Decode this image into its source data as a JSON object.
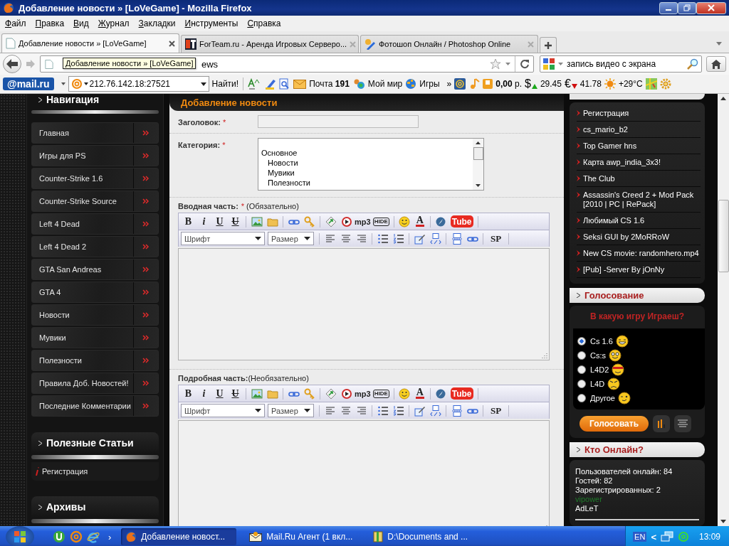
{
  "window": {
    "title": "Добавление новости » [LoVeGame] - Mozilla Firefox"
  },
  "menu": [
    "Файл",
    "Правка",
    "Вид",
    "Журнал",
    "Закладки",
    "Инструменты",
    "Справка"
  ],
  "tabs": [
    {
      "title": "Добавление новости » [LoVeGame]",
      "selected": true,
      "kind": "page"
    },
    {
      "title": "ForTeam.ru - Аренда Игровых Серверо...",
      "selected": false,
      "kind": "ft"
    },
    {
      "title": "Фотошоп Онлайн / Photoshop Online",
      "selected": false,
      "kind": "paint"
    }
  ],
  "address": {
    "value": "ews",
    "tooltip": "Добавление новости » [LoVeGame]"
  },
  "search": {
    "value": "запись видео с экрана"
  },
  "mail_toolbar": {
    "logo": "@mail.ru",
    "query": "212.76.142.18:27521",
    "find": "Найти!",
    "mail": "Почта **191**",
    "myworld": "Мой мир",
    "games": "Игры",
    "more": "»",
    "balance": "**0,00** р.",
    "rates": [
      {
        "symbol": "$",
        "rising": true,
        "value": "29.45"
      },
      {
        "symbol": "€",
        "rising": false,
        "value": "41.78"
      }
    ],
    "weather": "+29°C"
  },
  "nav": {
    "title": "Навигация",
    "items": [
      "Главная",
      "Игры для PS",
      "Counter-Strike 1.6",
      "Counter-Strike Source",
      "Left 4 Dead",
      "Left 4 Dead 2",
      "GTA San Andreas",
      "GTA 4",
      "Новости",
      "Мувики",
      "Полезности",
      "Правила Доб. Новостей!",
      "Последние Комментарии"
    ]
  },
  "articles": {
    "title": "Полезные Статьи",
    "items": [
      "Регистрация"
    ]
  },
  "archives": {
    "title": "Архивы"
  },
  "form": {
    "title": "Добавление новости",
    "title_field": {
      "label": "Заголовок:",
      "mark": "*"
    },
    "category": {
      "label": "Категория:",
      "mark": "*",
      "options": [
        {
          "text": "Основное",
          "selected": false,
          "children": [
            {
              "text": "Новости",
              "selected": false
            },
            {
              "text": "Мувики",
              "selected": false
            },
            {
              "text": "Полезности",
              "selected": false
            }
          ]
        }
      ]
    },
    "editors": [
      {
        "label": "Вводная часть:",
        "mark": "*",
        "note": "(Обязательно)",
        "toolbar": [
          [
            {
              "kind": "bold",
              "label": "B"
            },
            {
              "kind": "italic",
              "label": "i"
            },
            {
              "kind": "underline",
              "label": "U"
            },
            {
              "kind": "strike",
              "label": "U"
            },
            {
              "kind": "sep"
            },
            {
              "kind": "image"
            },
            {
              "kind": "folder"
            },
            {
              "kind": "sep"
            },
            {
              "kind": "link"
            },
            {
              "kind": "key"
            },
            {
              "kind": "sep"
            },
            {
              "kind": "leaf"
            },
            {
              "kind": "play"
            },
            {
              "kind": "mp3",
              "label": "mp3"
            },
            {
              "kind": "hide",
              "label": "HIDE"
            },
            {
              "kind": "sep"
            },
            {
              "kind": "smiley"
            },
            {
              "kind": "color",
              "label": "A"
            },
            {
              "kind": "sep"
            },
            {
              "kind": "compass"
            },
            {
              "kind": "tube",
              "label": "Tube"
            },
            {
              "kind": "sep"
            }
          ],
          [
            {
              "kind": "select",
              "label": "Шрифт"
            },
            {
              "kind": "select",
              "label": "Размер"
            },
            {
              "kind": "sep"
            },
            {
              "kind": "align-left"
            },
            {
              "kind": "align-center"
            },
            {
              "kind": "align-right"
            },
            {
              "kind": "sep"
            },
            {
              "kind": "ul"
            },
            {
              "kind": "ol"
            },
            {
              "kind": "sep"
            },
            {
              "kind": "edit"
            },
            {
              "kind": "code"
            },
            {
              "kind": "sep"
            },
            {
              "kind": "page"
            },
            {
              "kind": "link2"
            },
            {
              "kind": "sep"
            },
            {
              "kind": "sp",
              "label": "SP"
            },
            {
              "kind": "sep"
            }
          ]
        ]
      },
      {
        "label": "Подробная часть:",
        "note": "(Необязательно)",
        "toolbar": [
          [
            {
              "kind": "bold",
              "label": "B"
            },
            {
              "kind": "italic",
              "label": "i"
            },
            {
              "kind": "underline",
              "label": "U"
            },
            {
              "kind": "strike",
              "label": "U"
            },
            {
              "kind": "sep"
            },
            {
              "kind": "image"
            },
            {
              "kind": "folder"
            },
            {
              "kind": "sep"
            },
            {
              "kind": "link"
            },
            {
              "kind": "key"
            },
            {
              "kind": "sep"
            },
            {
              "kind": "leaf"
            },
            {
              "kind": "play"
            },
            {
              "kind": "mp3",
              "label": "mp3"
            },
            {
              "kind": "hide",
              "label": "HIDE"
            },
            {
              "kind": "sep"
            },
            {
              "kind": "smiley"
            },
            {
              "kind": "color",
              "label": "A"
            },
            {
              "kind": "sep"
            },
            {
              "kind": "compass"
            },
            {
              "kind": "tube",
              "label": "Tube"
            },
            {
              "kind": "sep"
            }
          ],
          [
            {
              "kind": "select",
              "label": "Шрифт"
            },
            {
              "kind": "select",
              "label": "Размер"
            },
            {
              "kind": "sep"
            },
            {
              "kind": "align-left"
            },
            {
              "kind": "align-center"
            },
            {
              "kind": "align-right"
            },
            {
              "kind": "sep"
            },
            {
              "kind": "ul"
            },
            {
              "kind": "ol"
            },
            {
              "kind": "sep"
            },
            {
              "kind": "edit"
            },
            {
              "kind": "code"
            },
            {
              "kind": "sep"
            },
            {
              "kind": "page"
            },
            {
              "kind": "link2"
            },
            {
              "kind": "sep"
            },
            {
              "kind": "sp",
              "label": "SP"
            },
            {
              "kind": "sep"
            }
          ]
        ]
      }
    ]
  },
  "popular": {
    "items": [
      "Регистрация",
      "cs_mario_b2",
      "Top Gamer hns",
      "Карта awp_india_3x3!",
      "The Club",
      "Assassin's Creed 2 + Mod Pack [2010 | PC | RePack]",
      "Любимый CS 1.6",
      "Seksi GUI by 2MoRRoW",
      "New CS movie: randomhero.mp4",
      "[Pub] -Server By jOnNy"
    ]
  },
  "poll": {
    "title": "Голосование",
    "question": "В какую игру Играеш?",
    "options": [
      {
        "label": "Cs 1.6",
        "selected": true,
        "kind": "laugh"
      },
      {
        "label": "Cs:s",
        "selected": false,
        "kind": "smile"
      },
      {
        "label": "L4D2",
        "selected": false,
        "kind": "band"
      },
      {
        "label": "L4D",
        "selected": false,
        "kind": "angry"
      },
      {
        "label": "Другое",
        "selected": false,
        "kind": "wink"
      }
    ],
    "vote": "Голосовать"
  },
  "online": {
    "title": "Кто Онлайн?",
    "lines": [
      "Пользователей онлайн: 84",
      "Гостей: 82",
      "Зарегистрированных: 2"
    ],
    "users": [
      {
        "name": "vipower",
        "color": "#1f7a2a"
      },
      {
        "name": "AdLeT",
        "color": "#ffffff"
      }
    ]
  },
  "taskbar": {
    "more": "›",
    "tasks": [
      {
        "title": "Добавление новост...",
        "selected": true,
        "kind": "firefox"
      },
      {
        "title": "Mail.Ru Агент (1 вкл...",
        "selected": false,
        "kind": "mail"
      },
      {
        "title": "D:\\Documents and ...",
        "selected": false,
        "kind": "folder"
      }
    ],
    "lang": "EN",
    "expand": "<",
    "clock": "13:09"
  }
}
